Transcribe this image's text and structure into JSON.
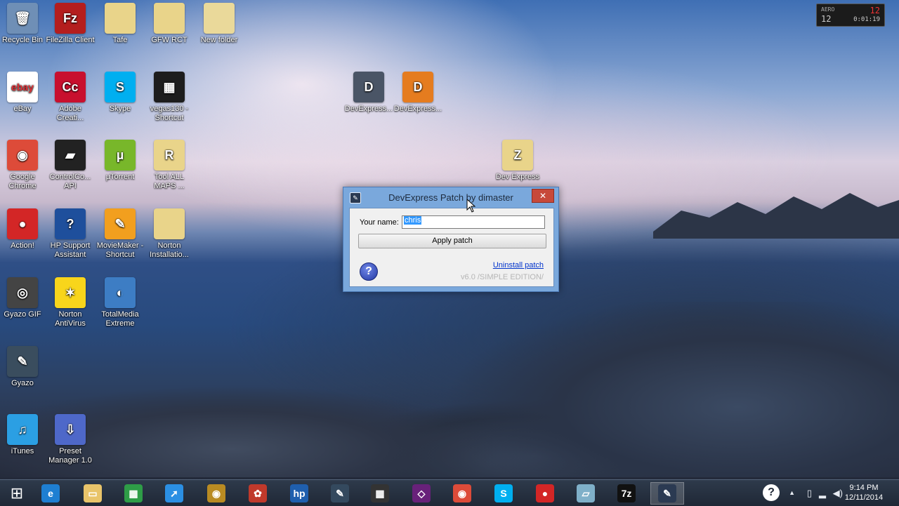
{
  "desktop": {
    "icons": [
      {
        "label": "Recycle Bin",
        "glyph": "🗑",
        "bg": "#6f8fb6"
      },
      {
        "label": "FileZilla Client",
        "glyph": "Fz",
        "bg": "#b41e1e"
      },
      {
        "label": "Tafe",
        "glyph": "",
        "bg": "#e9d48a"
      },
      {
        "label": "GFW RCT",
        "glyph": "",
        "bg": "#e9d48a"
      },
      {
        "label": "New folder",
        "glyph": "",
        "bg": "#ead99a"
      },
      {
        "label": "eBay",
        "glyph": "ebay",
        "bg": "#ffffff"
      },
      {
        "label": "Adobe Creati...",
        "glyph": "Cc",
        "bg": "#c8102e"
      },
      {
        "label": "Skype",
        "glyph": "S",
        "bg": "#00aff0"
      },
      {
        "label": "vegas130 - Shortcut",
        "glyph": "▦",
        "bg": "#1d1d1d"
      },
      {
        "label": "DevExpress...",
        "glyph": "D",
        "bg": "#4a5566"
      },
      {
        "label": "DevExpress...",
        "glyph": "D",
        "bg": "#e57c1f"
      },
      {
        "label": "Google Chrome",
        "glyph": "◉",
        "bg": "#dd4b39"
      },
      {
        "label": "ControlCo... API",
        "glyph": "▰",
        "bg": "#222222"
      },
      {
        "label": "µTorrent",
        "glyph": "µ",
        "bg": "#78b72a"
      },
      {
        "label": "Tool ALL MAPS ...",
        "glyph": "R",
        "bg": "#e9d48a"
      },
      {
        "label": "Dev Express",
        "glyph": "Z",
        "bg": "#e9d48a"
      },
      {
        "label": "Action!",
        "glyph": "●",
        "bg": "#d32626"
      },
      {
        "label": "HP Support Assistant",
        "glyph": "?",
        "bg": "#1e4f9c"
      },
      {
        "label": "MovieMaker - Shortcut",
        "glyph": "✎",
        "bg": "#f29f1e"
      },
      {
        "label": "Norton Installatio...",
        "glyph": "",
        "bg": "#e9d48a"
      },
      {
        "label": "Gyazo GIF",
        "glyph": "◎",
        "bg": "#444444"
      },
      {
        "label": "Norton AntiVirus",
        "glyph": "✶",
        "bg": "#f8d51b"
      },
      {
        "label": "TotalMedia Extreme",
        "glyph": "◐",
        "bg": "#3d7dc4"
      },
      {
        "label": "Gyazo",
        "glyph": "✎",
        "bg": "#3a4d5e"
      },
      {
        "label": "iTunes",
        "glyph": "♫",
        "bg": "#2b9fe3"
      },
      {
        "label": "Preset Manager 1.0",
        "glyph": "⇩",
        "bg": "#4e68c9"
      }
    ]
  },
  "clock_widget": {
    "line1": "AERO",
    "line2": "12",
    "line3": "12",
    "line4": "0:01:19"
  },
  "dialog": {
    "title": "DevExpress Patch by dimaster",
    "close_label": "✕",
    "name_label": "Your name:",
    "name_value": "chris",
    "apply_label": "Apply patch",
    "uninstall_label": "Uninstall patch",
    "version": "v6.0 /SIMPLE EDITION/",
    "help_glyph": "?"
  },
  "taskbar": {
    "items": [
      {
        "name": "start",
        "glyph": "⊞",
        "bg": "transparent"
      },
      {
        "name": "internet-explorer",
        "glyph": "e",
        "bg": "#1e7fd2"
      },
      {
        "name": "file-explorer",
        "glyph": "▭",
        "bg": "#e9c46a"
      },
      {
        "name": "store",
        "glyph": "▦",
        "bg": "#2e9d47"
      },
      {
        "name": "app-rocket",
        "glyph": "➚",
        "bg": "#2b8fe3"
      },
      {
        "name": "media-player",
        "glyph": "◉",
        "bg": "#b98b22"
      },
      {
        "name": "photo-app",
        "glyph": "✿",
        "bg": "#c0392b"
      },
      {
        "name": "hp",
        "glyph": "hp",
        "bg": "#1f5fae"
      },
      {
        "name": "gyazo",
        "glyph": "✎",
        "bg": "#34495e"
      },
      {
        "name": "vegas",
        "glyph": "▦",
        "bg": "#333333"
      },
      {
        "name": "visual-studio",
        "glyph": "◇",
        "bg": "#68217a"
      },
      {
        "name": "chrome",
        "glyph": "◉",
        "bg": "#dd4b39"
      },
      {
        "name": "skype",
        "glyph": "S",
        "bg": "#00aff0"
      },
      {
        "name": "action",
        "glyph": "●",
        "bg": "#d32626"
      },
      {
        "name": "notepad",
        "glyph": "▱",
        "bg": "#7fb0c9"
      },
      {
        "name": "7zip",
        "glyph": "7z",
        "bg": "#111111"
      },
      {
        "name": "devexpress-patch",
        "glyph": "✎",
        "bg": "#2b3a52"
      }
    ],
    "tray": {
      "time": "9:14 PM",
      "date": "12/11/2014",
      "help": "?",
      "arrow": "▲",
      "icons": [
        "▯",
        "▂",
        "◀)"
      ]
    }
  }
}
